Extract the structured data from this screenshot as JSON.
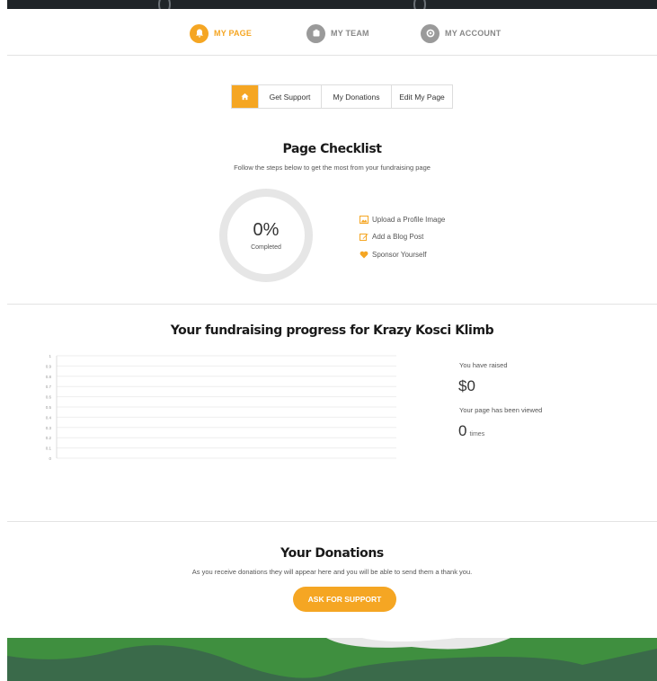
{
  "nav": {
    "items": [
      {
        "label": "MY PAGE",
        "icon": "bell-icon",
        "active": true
      },
      {
        "label": "MY TEAM",
        "icon": "team-icon",
        "active": false
      },
      {
        "label": "MY ACCOUNT",
        "icon": "account-icon",
        "active": false
      }
    ]
  },
  "tabs": {
    "home_icon": "home-icon",
    "items": [
      "Get Support",
      "My Donations",
      "Edit My Page"
    ]
  },
  "checklist": {
    "title": "Page Checklist",
    "subtitle": "Follow the steps below to get the most from your fundraising page",
    "percent": "0%",
    "percent_label": "Completed",
    "completion_fraction": 0,
    "items": [
      {
        "label": "Upload a Profile Image",
        "icon": "image-icon"
      },
      {
        "label": "Add a Blog Post",
        "icon": "edit-icon"
      },
      {
        "label": "Sponsor Yourself",
        "icon": "heart-icon"
      }
    ]
  },
  "progress": {
    "title": "Your fundraising progress for Krazy Kosci Klimb",
    "raised_label": "You have raised",
    "raised_value": "$0",
    "views_label": "Your page has been viewed",
    "views_value": "0",
    "views_unit": "times"
  },
  "chart_data": {
    "type": "line",
    "y_ticks": [
      "1",
      "0.9",
      "0.8",
      "0.7",
      "0.6",
      "0.5",
      "0.4",
      "0.3",
      "0.2",
      "0.1",
      "0"
    ],
    "ylim": [
      0,
      1
    ],
    "series": [],
    "grid": true
  },
  "donations": {
    "title": "Your Donations",
    "subtitle": "As you receive donations they will appear here and you will be able to send them a thank you.",
    "button_label": "ASK FOR SUPPORT"
  },
  "colors": {
    "accent": "#f5a623",
    "grass": "#3f8f3f",
    "grass_dark": "#3a6a4a",
    "banner": "#1f2428"
  }
}
